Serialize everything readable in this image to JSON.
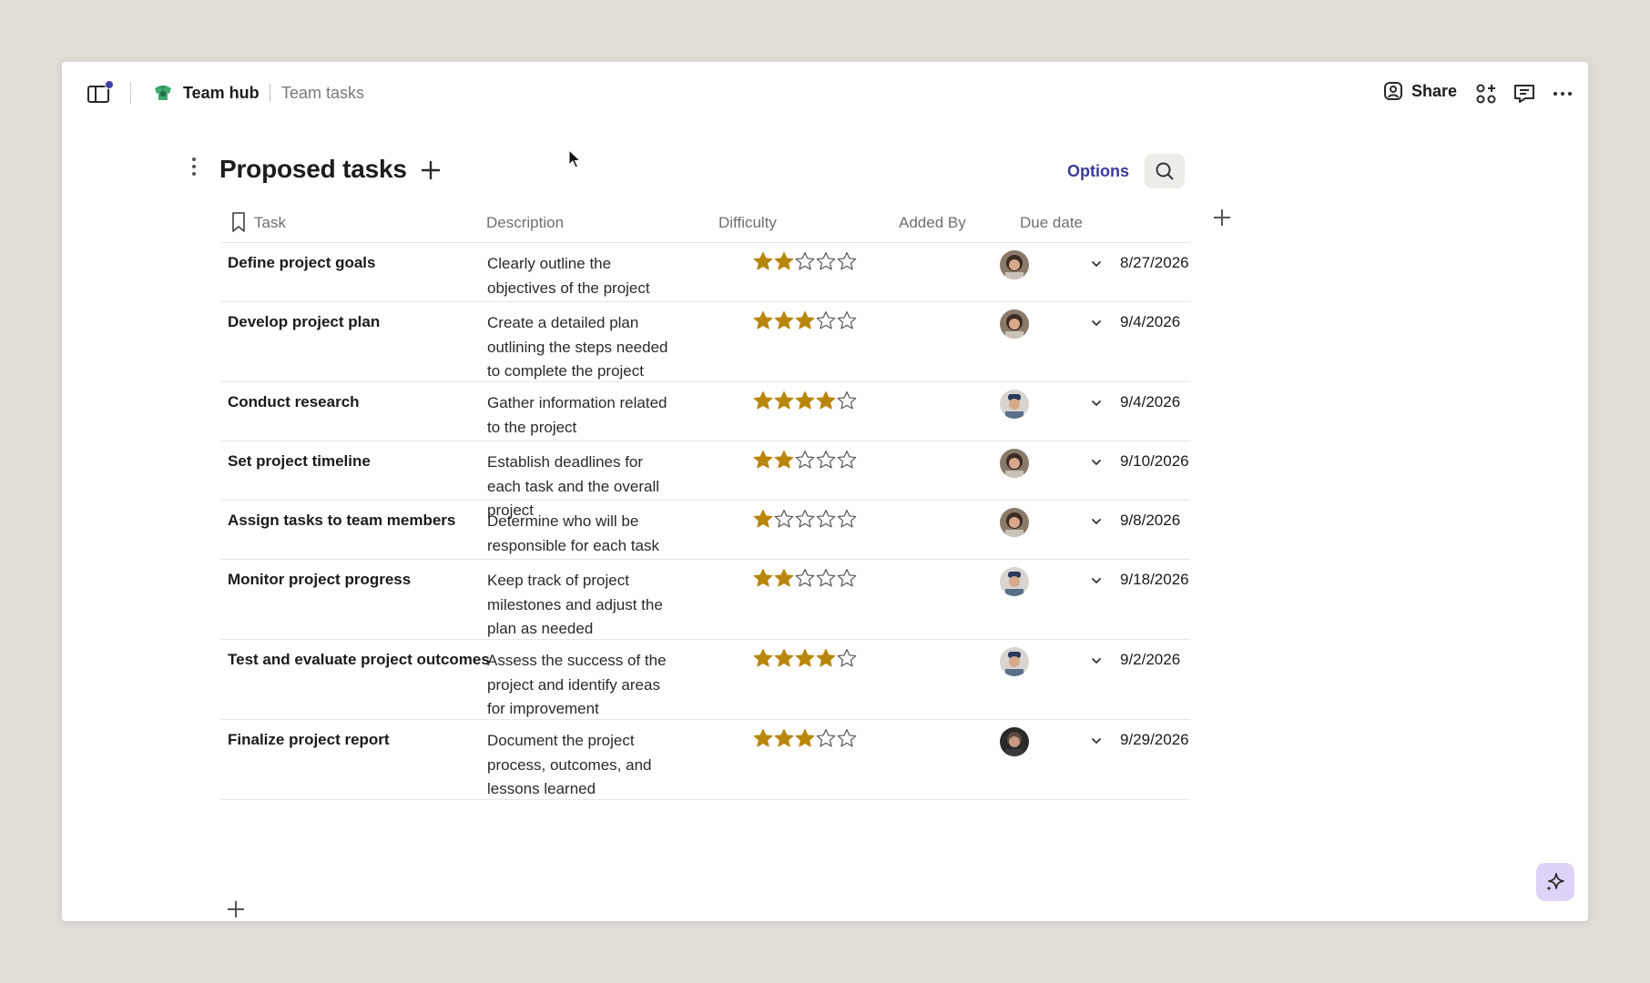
{
  "topbar": {
    "hub_name": "Team hub",
    "page_name": "Team tasks",
    "share_label": "Share"
  },
  "header": {
    "title": "Proposed tasks",
    "options_label": "Options"
  },
  "table": {
    "columns": [
      "Task",
      "Description",
      "Difficulty",
      "Added By",
      "Due date"
    ],
    "max_stars": 5,
    "star_color": "#b8860b",
    "rows": [
      {
        "task": "Define project goals",
        "description": "Clearly outline the objectives of the project",
        "difficulty": 2,
        "added_by": "woman-avatar",
        "due": "8/27/2026"
      },
      {
        "task": "Develop project plan",
        "description": "Create a detailed plan outlining the steps needed to complete the project",
        "difficulty": 3,
        "added_by": "woman-avatar",
        "due": "9/4/2026"
      },
      {
        "task": "Conduct research",
        "description": "Gather information related to the project",
        "difficulty": 4,
        "added_by": "man-avatar",
        "due": "9/4/2026"
      },
      {
        "task": "Set project timeline",
        "description": "Establish deadlines for each task and the overall project",
        "difficulty": 2,
        "added_by": "woman-avatar",
        "due": "9/10/2026"
      },
      {
        "task": "Assign tasks to team members",
        "description": "Determine who will be responsible for each task",
        "difficulty": 1,
        "added_by": "woman-avatar",
        "due": "9/8/2026"
      },
      {
        "task": "Monitor project progress",
        "description": "Keep track of project milestones and adjust the plan as needed",
        "difficulty": 2,
        "added_by": "man-avatar",
        "due": "9/18/2026"
      },
      {
        "task": "Test and evaluate project outcomes",
        "description": "Assess the success of the project and identify areas for improvement",
        "difficulty": 4,
        "added_by": "man-avatar",
        "due": "9/2/2026"
      },
      {
        "task": "Finalize project report",
        "description": "Document the project process, outcomes, and lessons learned",
        "difficulty": 3,
        "added_by": "dark-man-avatar",
        "due": "9/29/2026"
      }
    ]
  }
}
